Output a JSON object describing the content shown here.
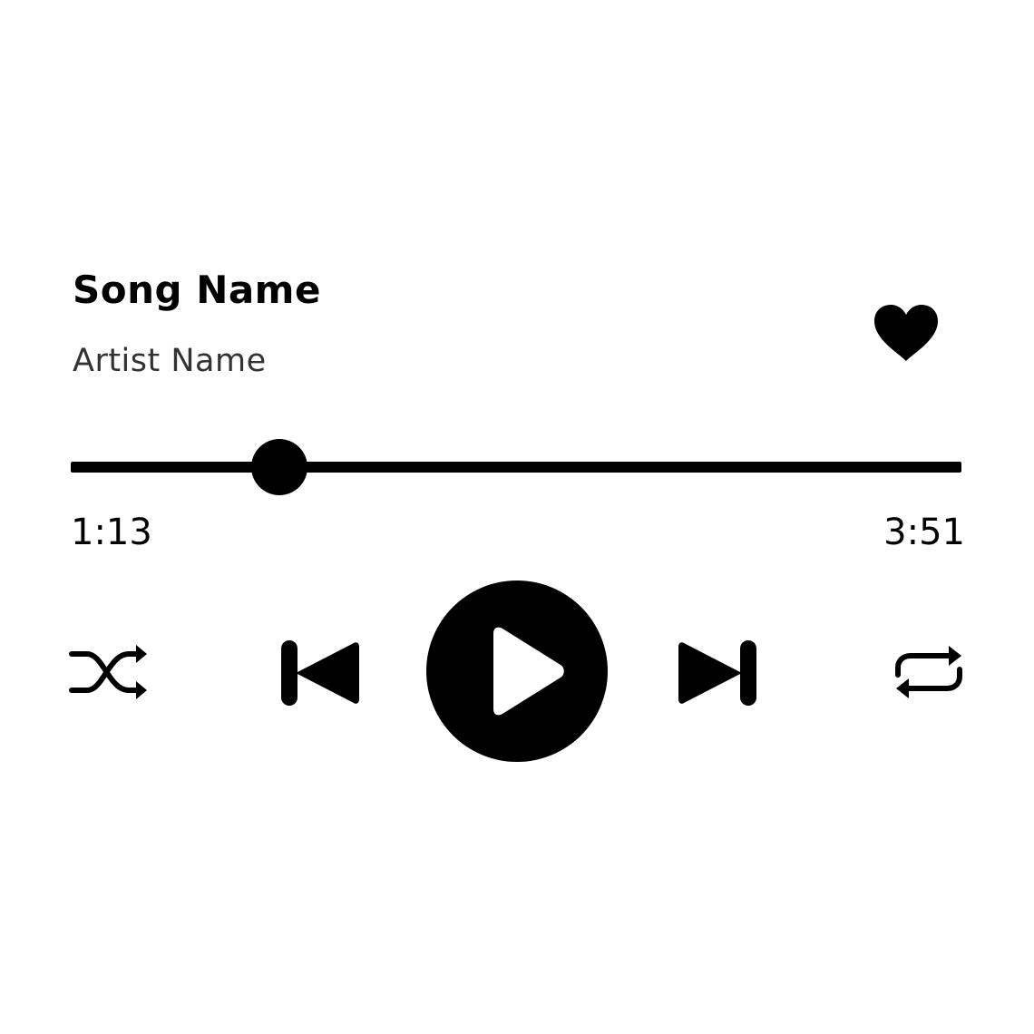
{
  "track": {
    "title": "Song Name",
    "artist": "Artist Name"
  },
  "playback": {
    "elapsed": "1:13",
    "total": "3:51",
    "progress_fraction": 0.234,
    "state": "paused"
  },
  "controls": {
    "shuffle_icon": "shuffle-icon",
    "previous_icon": "skip-previous-icon",
    "play_icon": "play-icon",
    "next_icon": "skip-next-icon",
    "repeat_icon": "repeat-icon",
    "like_icon": "heart-icon"
  },
  "colors": {
    "foreground": "#000000",
    "background": "#ffffff"
  }
}
